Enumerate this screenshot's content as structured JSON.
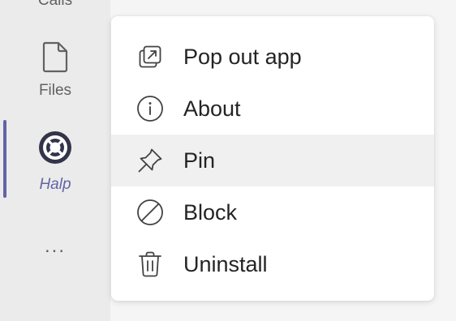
{
  "app_rail": {
    "items": [
      {
        "label": "Calls",
        "icon": "phone-icon",
        "active": false
      },
      {
        "label": "Files",
        "icon": "file-icon",
        "active": false
      },
      {
        "label": "Halp",
        "icon": "lifebuoy-icon",
        "active": true
      },
      {
        "label": "...",
        "icon": "more-icon",
        "active": false
      }
    ],
    "accent_color": "#6264a7"
  },
  "menu": {
    "items": [
      {
        "label": "Pop out app",
        "icon": "pop-out-icon"
      },
      {
        "label": "About",
        "icon": "info-icon"
      },
      {
        "label": "Pin",
        "icon": "pin-icon",
        "highlighted": true
      },
      {
        "label": "Block",
        "icon": "block-icon"
      },
      {
        "label": "Uninstall",
        "icon": "trash-icon"
      }
    ]
  }
}
